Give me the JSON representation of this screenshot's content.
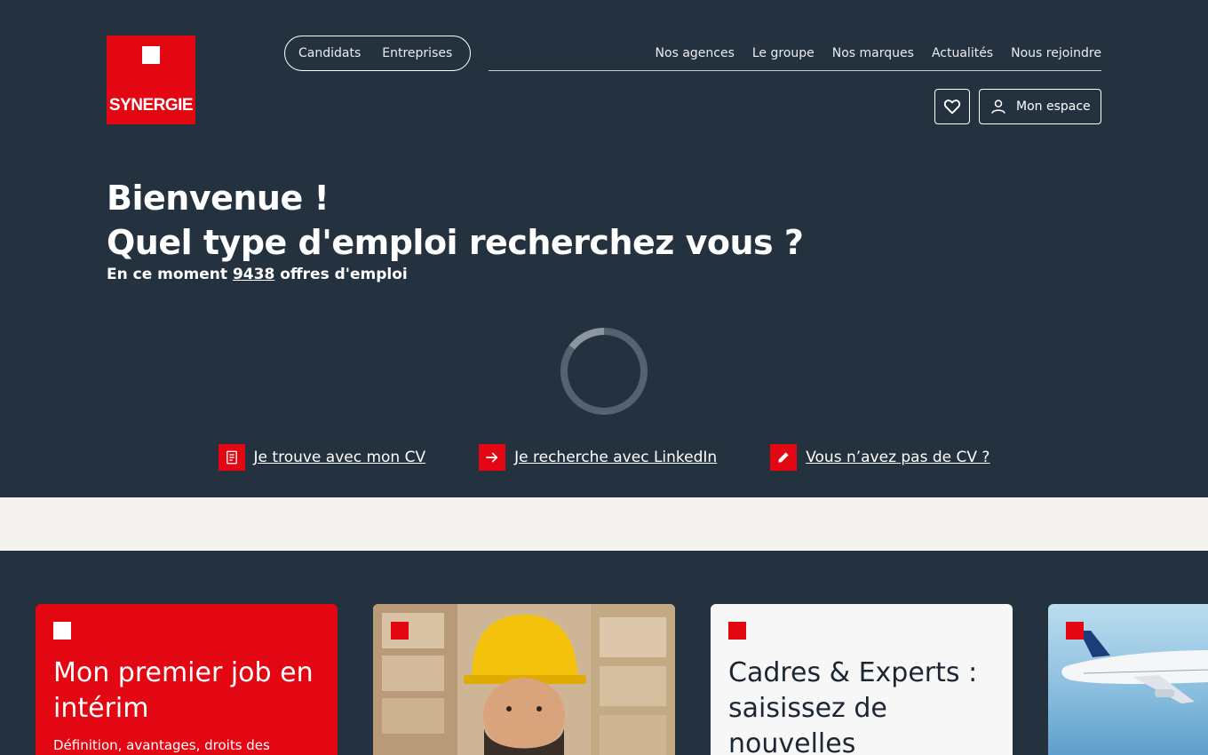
{
  "brand": {
    "name": "SYNERGIE",
    "accent": "#e30613",
    "background": "#243240"
  },
  "audience": {
    "items": [
      "Candidats",
      "Entreprises"
    ]
  },
  "topnav": {
    "items": [
      "Nos agences",
      "Le groupe",
      "Nos marques",
      "Actualités",
      "Nous rejoindre"
    ]
  },
  "header": {
    "favorites_icon": "heart-icon",
    "account_label": "Mon espace",
    "account_icon": "user-icon"
  },
  "hero": {
    "title_line1": "Bienvenue !",
    "title_line2": "Quel type d'emploi recherchez vous ?",
    "sub_prefix": "En ce moment",
    "offer_count": "9438",
    "sub_suffix": "offres d'emploi",
    "loading": true
  },
  "quick_links": [
    {
      "label": "Je trouve avec mon CV",
      "icon": "document-icon"
    },
    {
      "label": "Je recherche avec LinkedIn",
      "icon": "arrow-right-icon"
    },
    {
      "label": "Vous n’avez pas de CV ?",
      "icon": "pencil-icon"
    }
  ],
  "cards": [
    {
      "title": "Mon premier job en intérim",
      "description": "Définition, avantages, droits des",
      "style": "red"
    },
    {
      "title": "",
      "image": "worker-with-hard-hat",
      "style": "photo"
    },
    {
      "title": "Cadres & Experts : saisissez de nouvelles",
      "style": "light"
    },
    {
      "title": "",
      "image": "airplane-in-sky",
      "style": "photo"
    }
  ]
}
